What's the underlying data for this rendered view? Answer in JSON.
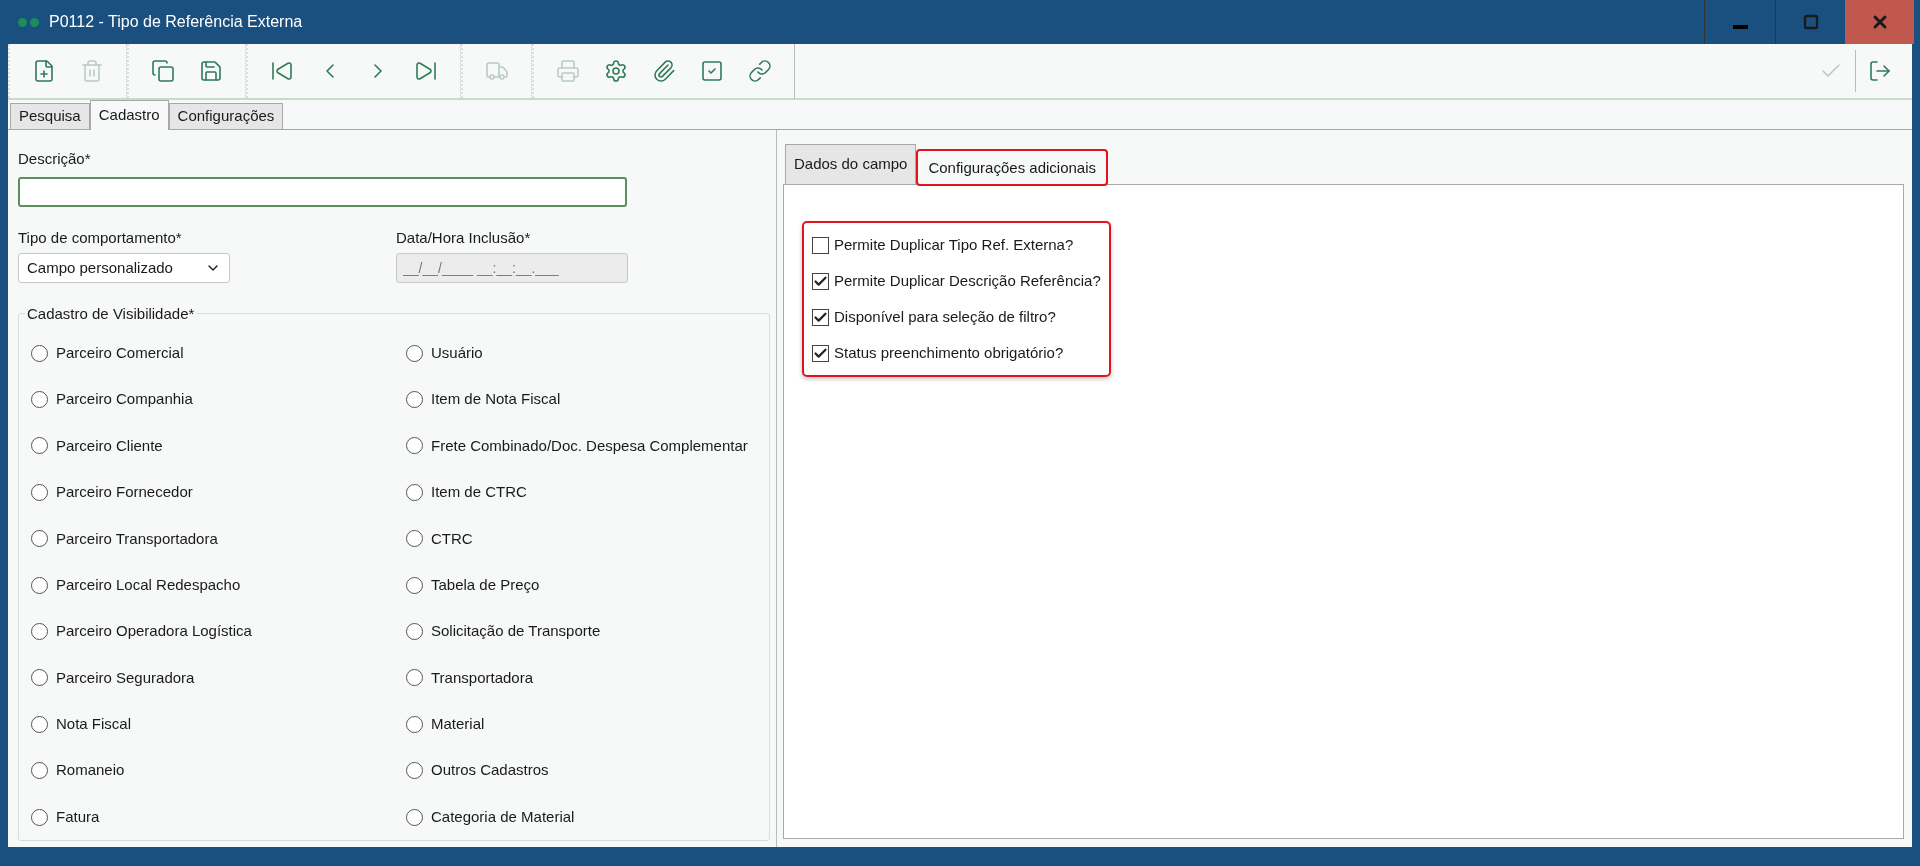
{
  "window": {
    "title": "P0112 - Tipo de Referência Externa"
  },
  "toolbar": {
    "groups": [
      [
        {
          "kind": "new",
          "disabled": false
        },
        {
          "kind": "delete",
          "disabled": true
        }
      ],
      [
        {
          "kind": "copy",
          "disabled": false
        },
        {
          "kind": "save",
          "disabled": false
        }
      ],
      [
        {
          "kind": "first",
          "disabled": false
        },
        {
          "kind": "prev",
          "disabled": false
        },
        {
          "kind": "next",
          "disabled": false
        },
        {
          "kind": "last",
          "disabled": false
        }
      ],
      [
        {
          "kind": "track",
          "disabled": true
        }
      ],
      [
        {
          "kind": "print",
          "disabled": true
        },
        {
          "kind": "settings",
          "disabled": false
        },
        {
          "kind": "attach",
          "disabled": false
        },
        {
          "kind": "check",
          "disabled": false
        },
        {
          "kind": "link",
          "disabled": false
        }
      ]
    ],
    "right": [
      {
        "kind": "confirm",
        "disabled": true
      },
      {
        "kind": "exit",
        "disabled": false
      }
    ]
  },
  "tabs": [
    {
      "label": "Pesquisa",
      "selected": false
    },
    {
      "label": "Cadastro",
      "selected": true
    },
    {
      "label": "Configurações",
      "selected": false
    }
  ],
  "form": {
    "descricao": {
      "label": "Descrição*"
    },
    "tipo": {
      "label": "Tipo de comportamento*",
      "value": "Campo personalizado"
    },
    "data_hora": {
      "label": "Data/Hora Inclusão*",
      "value": "__/__/____ __:__:__.___"
    },
    "visibilidade": {
      "title": "Cadastro de Visibilidade*",
      "options": [
        {
          "label": "Parceiro Comercial",
          "selected": false
        },
        {
          "label": "Parceiro Companhia",
          "selected": false
        },
        {
          "label": "Parceiro Cliente",
          "selected": false
        },
        {
          "label": "Parceiro Fornecedor",
          "selected": false
        },
        {
          "label": "Parceiro Transportadora",
          "selected": false
        },
        {
          "label": "Parceiro Local Redespacho",
          "selected": false
        },
        {
          "label": "Parceiro Operadora Logística",
          "selected": false
        },
        {
          "label": "Parceiro Seguradora",
          "selected": false
        },
        {
          "label": "Nota Fiscal",
          "selected": false
        },
        {
          "label": "Romaneio",
          "selected": false
        },
        {
          "label": "Fatura",
          "selected": false
        },
        {
          "label": "Usuário",
          "selected": false
        },
        {
          "label": "Item de Nota Fiscal",
          "selected": false
        },
        {
          "label": "Frete Combinado/Doc. Despesa Complementar",
          "selected": false
        },
        {
          "label": "Item de CTRC",
          "selected": false
        },
        {
          "label": "CTRC",
          "selected": false
        },
        {
          "label": "Tabela de Preço",
          "selected": false
        },
        {
          "label": "Solicitação de Transporte",
          "selected": false
        },
        {
          "label": "Transportadora",
          "selected": false
        },
        {
          "label": "Material",
          "selected": false
        },
        {
          "label": "Outros Cadastros",
          "selected": false
        },
        {
          "label": "Categoria de Material",
          "selected": false
        }
      ]
    }
  },
  "detail_tabs": [
    {
      "label": "Dados do campo",
      "selected": false,
      "highlighted": false
    },
    {
      "label": "Configurações adicionais",
      "selected": true,
      "highlighted": true
    }
  ],
  "options": {
    "highlighted": true,
    "items": [
      {
        "label": "Permite Duplicar Tipo Ref. Externa?",
        "checked": false
      },
      {
        "label": "Permite Duplicar Descrição Referência?",
        "checked": true
      },
      {
        "label": "Disponível para seleção de filtro?",
        "checked": true
      },
      {
        "label": "Status preenchimento obrigatório?",
        "checked": true
      }
    ]
  }
}
